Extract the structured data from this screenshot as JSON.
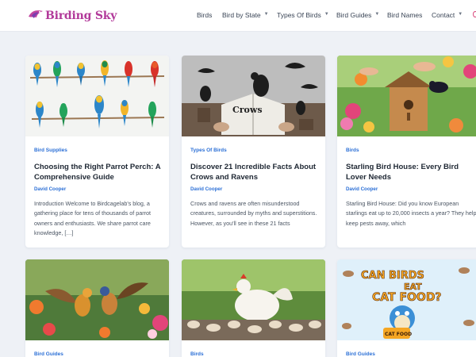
{
  "header": {
    "logo_text": "Birding Sky",
    "nav": [
      {
        "label": "Birds",
        "dropdown": false
      },
      {
        "label": "Bird by State",
        "dropdown": true
      },
      {
        "label": "Types Of Birds",
        "dropdown": true
      },
      {
        "label": "Bird Guides",
        "dropdown": true
      },
      {
        "label": "Bird Names",
        "dropdown": false
      },
      {
        "label": "Contact",
        "dropdown": true
      }
    ]
  },
  "cards": [
    {
      "category": "Bird Supplies",
      "title": "Choosing the Right Parrot Perch: A Comprehensive Guide",
      "author": "David Cooper",
      "excerpt": "Introduction Welcome to Birdcagelab's blog, a gathering place for tens of thousands of parrot owners and enthusiasts. We share parrot care knowledge, […]"
    },
    {
      "category": "Types Of Birds",
      "title": "Discover 21 Incredible Facts About Crows and Ravens",
      "author": "David Cooper",
      "excerpt": "Crows and ravens are often misunderstood creatures, surrounded by myths and superstitions. However, as you'll see in these 21 facts",
      "image_text": "Crows"
    },
    {
      "category": "Birds",
      "title": "Starling Bird House: Every Bird Lover Needs",
      "author": "David Cooper",
      "excerpt": "Starling Bird House: Did you know European starlings eat up to 20,000 insects a year? They help keep pests away, which"
    },
    {
      "category": "Bird Guides"
    },
    {
      "category": "Birds"
    },
    {
      "category": "Bird Guides",
      "image_text": [
        "CAN BIRDS",
        "EAT",
        "CAT FOOD?",
        "CAT FOOD"
      ]
    }
  ],
  "colors": {
    "logo": "#b23a9a",
    "link_blue": "#2b6fd6",
    "page_bg": "#eef1f6"
  }
}
